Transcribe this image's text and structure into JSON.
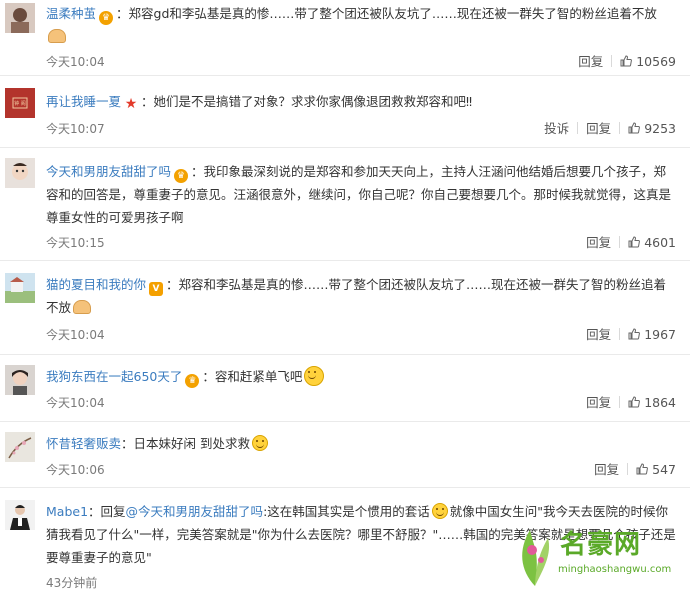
{
  "colors": {
    "username": "#3b7cbf",
    "meta": "#7a7a7a",
    "watermark": "#5aa928"
  },
  "comments": [
    {
      "user": "温柔种茧",
      "text": "：郑容gd和李弘基是真的惨……带了整个团还被队友坑了……现在还被一群失了智的粉丝追着不放",
      "time": "今天10:04",
      "actions": [
        "回复"
      ],
      "likes": "10569"
    },
    {
      "user": "再让我睡一夏",
      "text": "：她们是不是搞错了对象？求求你家偶像退团救救郑容和吧‼",
      "time": "今天10:07",
      "actions": [
        "投诉",
        "回复"
      ],
      "likes": "9253"
    },
    {
      "user": "今天和男朋友甜甜了吗",
      "text": "：我印象最深刻说的是郑容和参加天天向上，主持人汪涵问他结婚后想要几个孩子，郑容和的回答是，尊重妻子的意见。汪涵很意外，继续问，你自己呢？你自己要想要几个。那时候我就觉得，这真是尊重女性的可爱男孩子啊",
      "time": "今天10:15",
      "actions": [
        "回复"
      ],
      "likes": "4601"
    },
    {
      "user": "猫的夏目和我的你",
      "text": "：郑容和李弘基是真的惨……带了整个团还被队友坑了……现在还被一群失了智的粉丝追着不放",
      "time": "今天10:04",
      "actions": [
        "回复"
      ],
      "likes": "1967"
    },
    {
      "user": "我狗东西在一起650天了",
      "text": "：容和赶紧单飞吧",
      "time": "今天10:04",
      "actions": [
        "回复"
      ],
      "likes": "1864"
    },
    {
      "user": "怀昔轻奢贩卖",
      "text": "：日本妹好闲 到处求救",
      "time": "今天10:06",
      "actions": [
        "回复"
      ],
      "likes": "547"
    },
    {
      "user": "Mabe1",
      "text_before": "：回复",
      "reply_to": "@今天和男朋友甜甜了吗",
      "text": ":这在韩国其实是个惯用的套话",
      "text2": "就像中国女生问\"我今天去医院的时候你猜我看见了什么\"一样，完美答案就是\"你为什么去医院？哪里不舒服？\"……韩国的完美答案就是想要几个孩子还是要尊重妻子的意见\"",
      "time": "43分钟前"
    }
  ],
  "watermark": {
    "title": "名豪网",
    "url": "minghaoshangwu.com"
  }
}
